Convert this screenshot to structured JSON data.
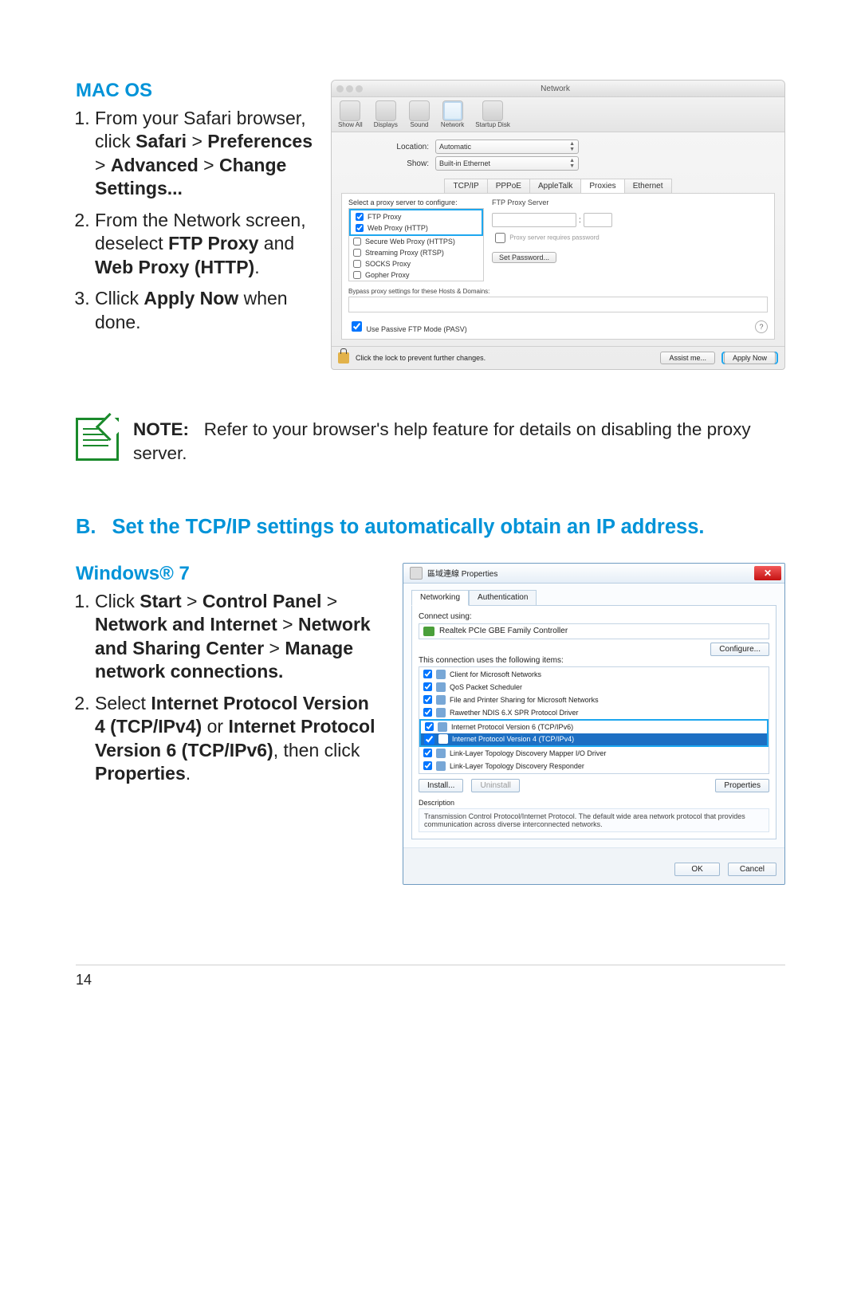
{
  "macos": {
    "heading": "MAC OS",
    "steps_html": [
      "From your Safari browser, click <b>Safari</b> > <b>Preferences</b> > <b>Advanced</b> > <b>Change Settings...</b>",
      "From the Network screen, deselect <b>FTP Proxy</b> and <b>Web Proxy (HTTP)</b>.",
      "Cllick <b>Apply Now</b> when done."
    ],
    "panel": {
      "title": "Network",
      "toolbar": [
        "Show All",
        "Displays",
        "Sound",
        "Network",
        "Startup Disk"
      ],
      "location_label": "Location:",
      "location_value": "Automatic",
      "show_label": "Show:",
      "show_value": "Built-in Ethernet",
      "tabs": [
        "TCP/IP",
        "PPPoE",
        "AppleTalk",
        "Proxies",
        "Ethernet"
      ],
      "proxy_select_label": "Select a proxy server to configure:",
      "ftp_header": "FTP Proxy Server",
      "proxy_items": [
        {
          "label": "FTP Proxy",
          "checked": true
        },
        {
          "label": "Web Proxy (HTTP)",
          "checked": true
        },
        {
          "label": "Secure Web Proxy (HTTPS)",
          "checked": false
        },
        {
          "label": "Streaming Proxy (RTSP)",
          "checked": false
        },
        {
          "label": "SOCKS Proxy",
          "checked": false
        },
        {
          "label": "Gopher Proxy",
          "checked": false
        }
      ],
      "requires_pw": "Proxy server requires password",
      "set_pw": "Set Password...",
      "bypass_label": "Bypass proxy settings for these Hosts & Domains:",
      "pasv": "Use Passive FTP Mode (PASV)",
      "lock_text": "Click the lock to prevent further changes.",
      "assist": "Assist me...",
      "apply": "Apply Now"
    }
  },
  "note": "<b>NOTE:</b>&nbsp;&nbsp;&nbsp;Refer to your browser's help feature for details on disabling the proxy server.",
  "sectionB": {
    "letter": "B.",
    "title": "Set the TCP/IP settings to automatically obtain an IP address."
  },
  "windows": {
    "heading": "Windows® 7",
    "steps_html": [
      "Click <b>Start</b> > <b>Control Panel</b> > <b>Network and Internet</b> > <b>Network and Sharing Center</b> > <b>Manage network connections.</b>",
      "Select <b>Internet Protocol Version 4 (TCP/IPv4)</b> or <b>Internet Protocol Version 6 (TCP/IPv6)</b>, then click <b>Properties</b>."
    ],
    "dialog": {
      "title": "區域連線 Properties",
      "tabs": [
        "Networking",
        "Authentication"
      ],
      "connect_using_label": "Connect using:",
      "nic": "Realtek PCIe GBE Family Controller",
      "configure": "Configure...",
      "items_label": "This connection uses the following items:",
      "items": [
        "Client for Microsoft Networks",
        "QoS Packet Scheduler",
        "File and Printer Sharing for Microsoft Networks",
        "Rawether NDIS 6.X SPR Protocol Driver",
        "Internet Protocol Version 6 (TCP/IPv6)",
        "Internet Protocol Version 4 (TCP/IPv4)",
        "Link-Layer Topology Discovery Mapper I/O Driver",
        "Link-Layer Topology Discovery Responder"
      ],
      "install": "Install...",
      "uninstall": "Uninstall",
      "properties": "Properties",
      "desc_label": "Description",
      "desc_text": "Transmission Control Protocol/Internet Protocol. The default wide area network protocol that provides communication across diverse interconnected networks.",
      "ok": "OK",
      "cancel": "Cancel"
    }
  },
  "page_number": "14"
}
